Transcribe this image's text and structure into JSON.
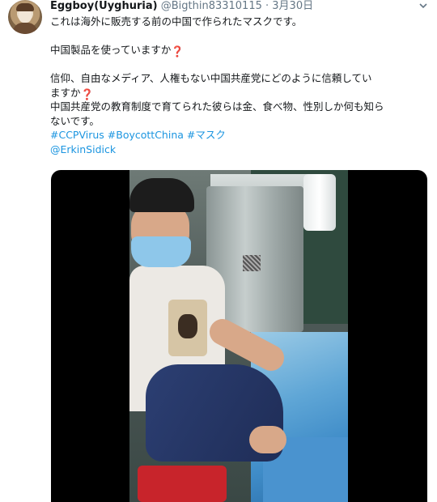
{
  "tweet": {
    "display_name": "Eggboy(Uyghuria)",
    "handle": "@Bigthin83310115",
    "separator": "·",
    "date": "3月30日",
    "lines": {
      "l1": "これは海外に販売する前の中国で作られたマスクです。",
      "l2": "中国製品を使っていますか",
      "l3a": "信仰、自由なメディア、人権もない中国共産党にどのように信頼してい",
      "l3b": "ますか",
      "l4a": "中国共産党の教育制度で育てられた彼らは金、食べ物、性別しか何も知ら",
      "l4b": "ないです。"
    },
    "emoji_question": "❓",
    "hashtags": [
      "#CCPVirus",
      "#BoycottChina",
      "#マスク"
    ],
    "mention": "@ErkinSidick"
  },
  "icons": {
    "caret": "chevron-down-icon",
    "emoji": "red-question-mark-emoji"
  },
  "colors": {
    "link": "#1b95e0",
    "muted": "#657786",
    "text": "#14171a"
  }
}
